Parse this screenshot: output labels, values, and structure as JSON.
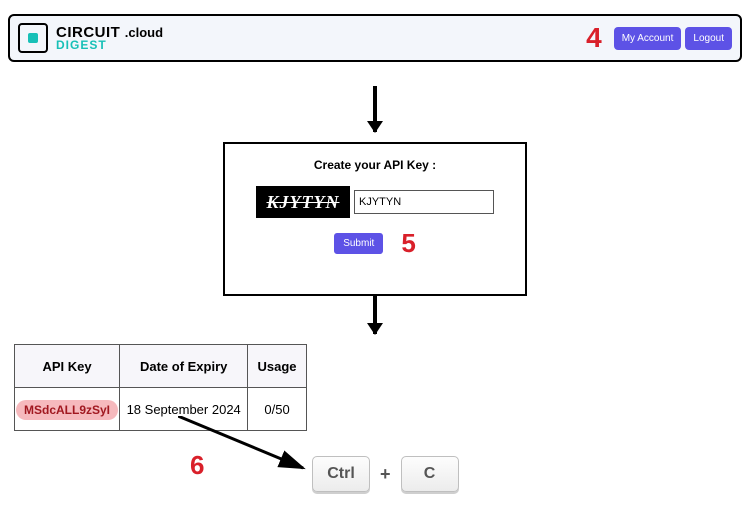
{
  "header": {
    "brand_top": "CIRCUIT",
    "brand_suffix": ".cloud",
    "brand_bottom": "DIGEST",
    "my_account": "My Account",
    "logout": "Logout"
  },
  "steps": {
    "n4": "4",
    "n5": "5",
    "n6": "6"
  },
  "panel": {
    "title": "Create your API Key :",
    "captcha_text": "KJYTYN",
    "input_value": "KJYTYN",
    "submit": "Submit"
  },
  "table": {
    "headers": {
      "key": "API Key",
      "expiry": "Date of Expiry",
      "usage": "Usage"
    },
    "row": {
      "key": "MSdcALL9zSyI",
      "expiry": "18 September 2024",
      "usage": "0/50"
    }
  },
  "keys": {
    "ctrl": "Ctrl",
    "plus": "+",
    "c": "C"
  }
}
